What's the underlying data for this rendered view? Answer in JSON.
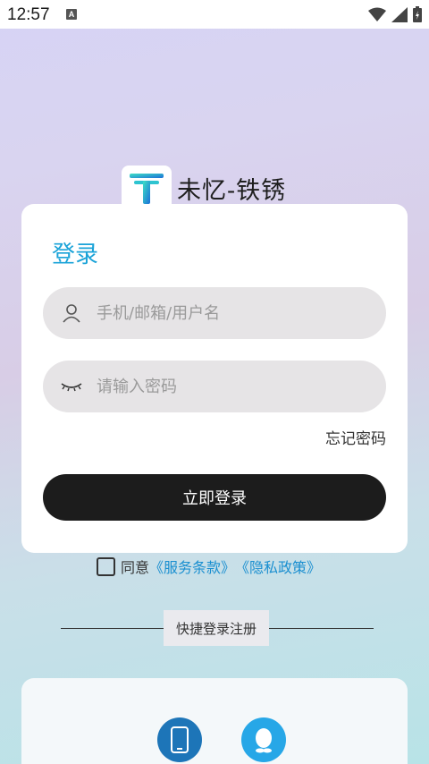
{
  "status_bar": {
    "time": "12:57",
    "notification_letter": "A"
  },
  "brand": {
    "name": "未忆-铁锈",
    "logo_letter": "T"
  },
  "login": {
    "title": "登录",
    "username_placeholder": "手机/邮箱/用户名",
    "password_placeholder": "请输入密码",
    "forgot_password": "忘记密码",
    "submit_label": "立即登录"
  },
  "agreement": {
    "prefix": "同意",
    "terms_link": "《服务条款》",
    "privacy_link": "《隐私政策》",
    "checked": false
  },
  "quick_login": {
    "label": "快捷登录注册",
    "options": [
      {
        "icon": "phone-icon",
        "color": "#1d75b8"
      },
      {
        "icon": "qq-icon",
        "color": "#27a7e7"
      }
    ]
  },
  "colors": {
    "accent": "#1aa3d8",
    "link": "#1a8fd0",
    "button": "#1c1c1c"
  }
}
